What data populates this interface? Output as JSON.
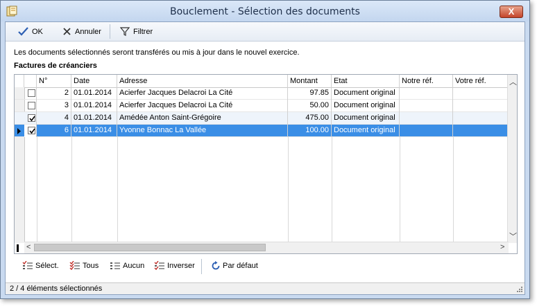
{
  "window": {
    "title": "Bouclement - Sélection des documents",
    "close_label": "X"
  },
  "toolbar": {
    "ok_label": "OK",
    "cancel_label": "Annuler",
    "filter_label": "Filtrer"
  },
  "info_text": "Les documents sélectionnés seront transférés ou mis à jour dans le nouvel exercice.",
  "section_title": "Factures de créanciers",
  "table": {
    "columns": [
      "N°",
      "Date",
      "Adresse",
      "Montant",
      "Etat",
      "Notre réf.",
      "Votre réf."
    ],
    "rows": [
      {
        "checked": false,
        "no": "2",
        "date": "01.01.2014",
        "address": "Acierfer Jacques Delacroi La Cité",
        "amount": "97.85",
        "state": "Document original",
        "our_ref": "",
        "your_ref": ""
      },
      {
        "checked": false,
        "no": "3",
        "date": "01.01.2014",
        "address": "Acierfer Jacques Delacroi La Cité",
        "amount": "50.00",
        "state": "Document original",
        "our_ref": "",
        "your_ref": ""
      },
      {
        "checked": true,
        "no": "4",
        "date": "01.01.2014",
        "address": "Amédée Anton Saint-Grégoire",
        "amount": "475.00",
        "state": "Document original",
        "our_ref": "",
        "your_ref": ""
      },
      {
        "checked": true,
        "no": "6",
        "date": "01.01.2014",
        "address": "Yvonne Bonnac La Vallée",
        "amount": "100.00",
        "state": "Document original",
        "our_ref": "",
        "your_ref": ""
      }
    ]
  },
  "actions": {
    "select_label": "Sélect.",
    "all_label": "Tous",
    "none_label": "Aucun",
    "invert_label": "Inverser",
    "default_label": "Par défaut"
  },
  "status": {
    "text": "2 / 4 éléments sélectionnés"
  },
  "colors": {
    "selection": "#3a8ee6",
    "title_bar": "#c9daf0",
    "close_button": "#c4442b"
  }
}
